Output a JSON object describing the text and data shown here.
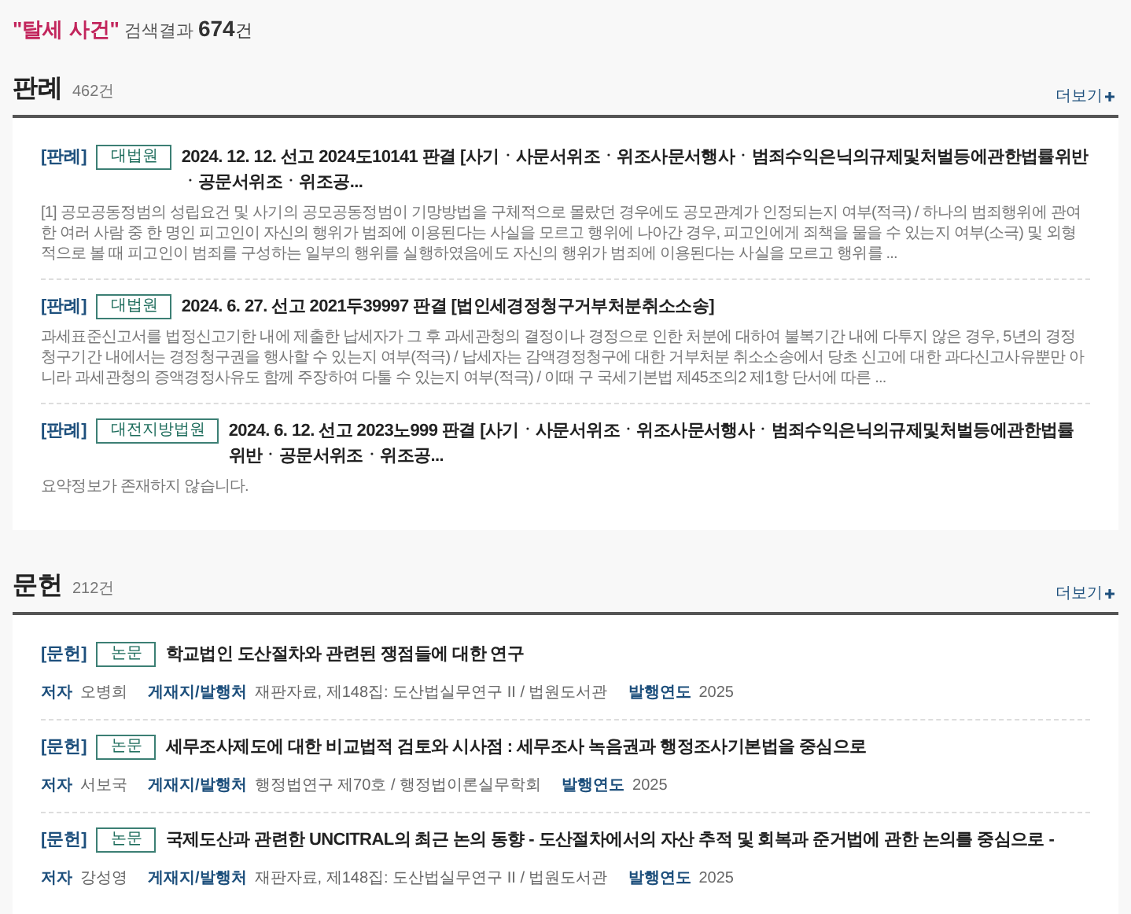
{
  "header": {
    "query": "\"탈세 사건\"",
    "label": "검색결과",
    "count": "674",
    "unit": "건"
  },
  "sections": [
    {
      "kind": "cases",
      "title": "판례",
      "count": "462건",
      "more": "더보기",
      "items": [
        {
          "tag": "[판례]",
          "court": "대법원",
          "title": "2024. 12. 12. 선고 2024도10141 판결 [사기ㆍ사문서위조ㆍ위조사문서행사ㆍ범죄수익은닉의규제및처벌등에관한법률위반ㆍ공문서위조ㆍ위조공...",
          "summary": "[1] 공모공동정범의 성립요건 및 사기의 공모공동정범이 기망방법을 구체적으로 몰랐던 경우에도 공모관계가 인정되는지 여부(적극) / 하나의 범죄행위에 관여한 여러 사람 중 한 명인 피고인이 자신의 행위가 범죄에 이용된다는 사실을 모르고 행위에 나아간 경우, 피고인에게 죄책을 물을 수 있는지 여부(소극) 및 외형적으로 볼 때 피고인이 범죄를 구성하는 일부의 행위를 실행하였음에도 자신의 행위가 범죄에 이용된다는 사실을 모르고 행위를 ..."
        },
        {
          "tag": "[판례]",
          "court": "대법원",
          "title": "2024. 6. 27. 선고 2021두39997 판결 [법인세경정청구거부처분취소소송]",
          "summary": "과세표준신고서를 법정신고기한 내에 제출한 납세자가 그 후 과세관청의 결정이나 경정으로 인한 처분에 대하여 불복기간 내에 다투지 않은 경우, 5년의 경정청구기간 내에서는 경정청구권을 행사할 수 있는지 여부(적극) / 납세자는 감액경정청구에 대한 거부처분 취소소송에서 당초 신고에 대한 과다신고사유뿐만 아니라 과세관청의 증액경정사유도 함께 주장하여 다툴 수 있는지 여부(적극) / 이때 구 국세기본법 제45조의2 제1항 단서에 따른 ..."
        },
        {
          "tag": "[판례]",
          "court": "대전지방법원",
          "title": "2024. 6. 12. 선고 2023노999 판결 [사기ㆍ사문서위조ㆍ위조사문서행사ㆍ범죄수익은닉의규제및처벌등에관한법률위반ㆍ공문서위조ㆍ위조공...",
          "summary": "요약정보가 존재하지 않습니다."
        }
      ]
    },
    {
      "kind": "literature",
      "title": "문헌",
      "count": "212건",
      "more": "더보기",
      "items": [
        {
          "tag": "[문헌]",
          "type": "논문",
          "title": "학교법인 도산절차와 관련된 쟁점들에 대한 연구",
          "meta": [
            {
              "label": "저자",
              "value": "오병희"
            },
            {
              "label": "게재지/발행처",
              "value": "재판자료, 제148집: 도산법실무연구 II / 법원도서관"
            },
            {
              "label": "발행연도",
              "value": "2025"
            }
          ]
        },
        {
          "tag": "[문헌]",
          "type": "논문",
          "title": "세무조사제도에 대한 비교법적 검토와 시사점 : 세무조사 녹음권과 행정조사기본법을 중심으로",
          "meta": [
            {
              "label": "저자",
              "value": "서보국"
            },
            {
              "label": "게재지/발행처",
              "value": "행정법연구 제70호 / 행정법이론실무학회"
            },
            {
              "label": "발행연도",
              "value": "2025"
            }
          ]
        },
        {
          "tag": "[문헌]",
          "type": "논문",
          "title": "국제도산과 관련한 UNCITRAL의 최근 논의 동향 - 도산절차에서의 자산 추적 및 회복과 준거법에 관한 논의를 중심으로 -",
          "meta": [
            {
              "label": "저자",
              "value": "강성영"
            },
            {
              "label": "게재지/발행처",
              "value": "재판자료, 제148집: 도산법실무연구 II / 법원도서관"
            },
            {
              "label": "발행연도",
              "value": "2025"
            }
          ]
        }
      ]
    }
  ]
}
